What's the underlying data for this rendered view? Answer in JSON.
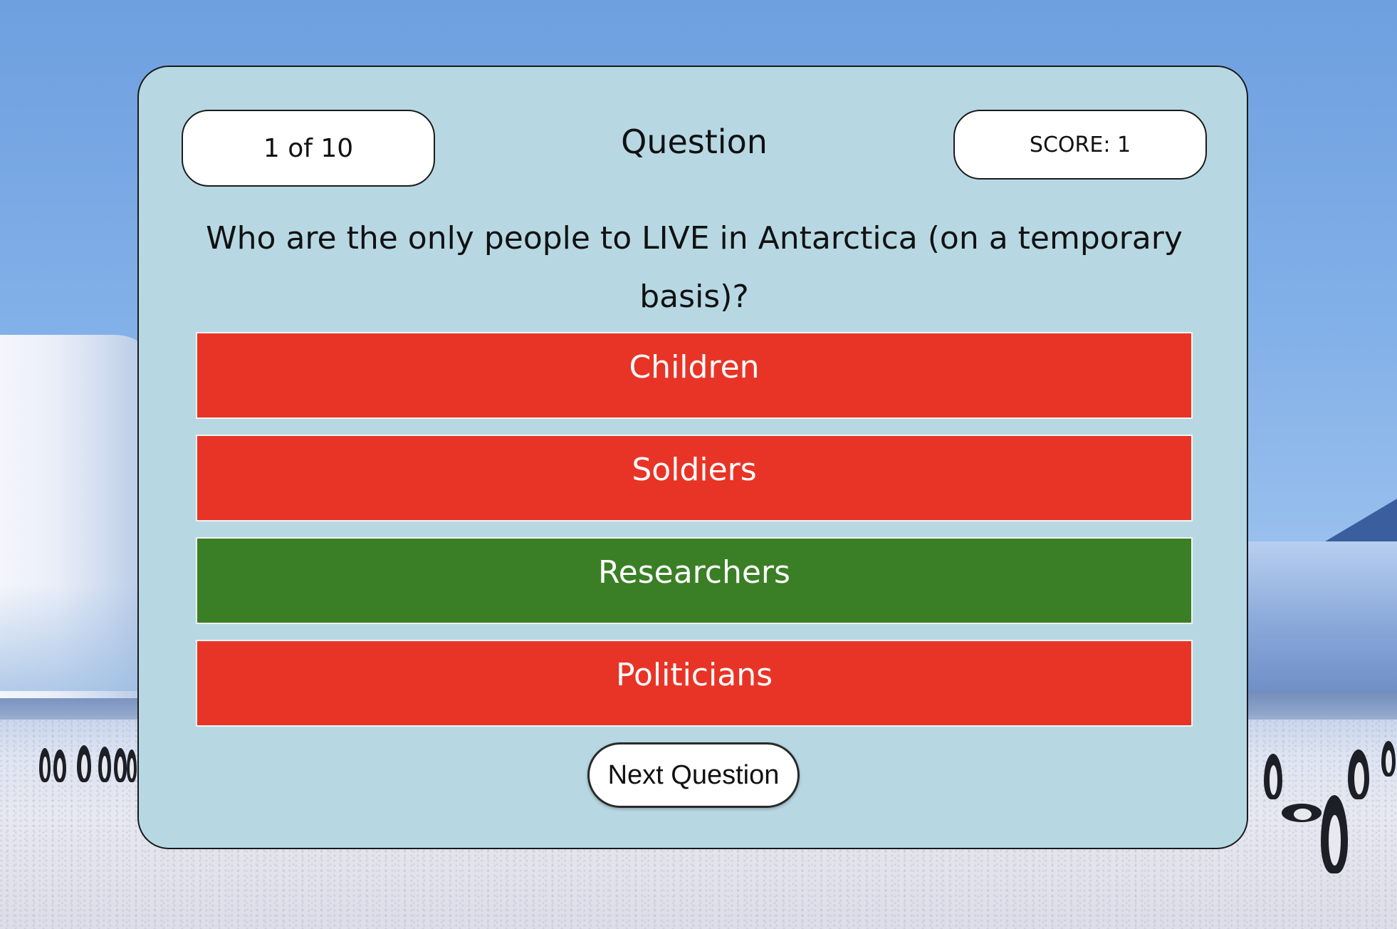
{
  "quiz": {
    "progress_text": "1 of 10",
    "heading": "Question",
    "score_text": "SCORE: 1",
    "question": "Who are the only people to LIVE in Antarctica (on a temporary basis)?",
    "answers": [
      {
        "label": "Children",
        "state": "incorrect"
      },
      {
        "label": "Soldiers",
        "state": "incorrect"
      },
      {
        "label": "Researchers",
        "state": "correct"
      },
      {
        "label": "Politicians",
        "state": "incorrect"
      }
    ],
    "next_button_label": "Next Question"
  },
  "colors": {
    "card_background": "#b7d8e3",
    "incorrect_answer": "#e83426",
    "correct_answer": "#3a7f25"
  },
  "background": {
    "scene": "antarctic-ice-with-penguins"
  }
}
